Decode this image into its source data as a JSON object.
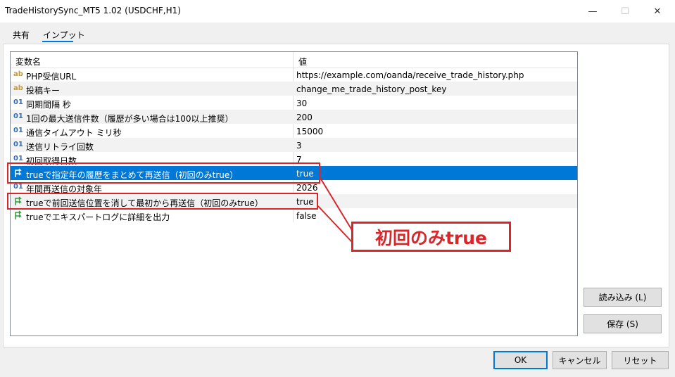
{
  "window": {
    "title": "TradeHistorySync_MT5 1.02 (USDCHF,H1)",
    "minimize_glyph": "—",
    "maximize_glyph": "☐",
    "close_glyph": "✕"
  },
  "tabs": [
    {
      "label": "共有",
      "selected": false
    },
    {
      "label": "インプット",
      "selected": true
    }
  ],
  "grid": {
    "headers": {
      "name": "変数名",
      "value": "値"
    },
    "rows": [
      {
        "icon": "ab",
        "name": "PHP受信URL",
        "value": "https://example.com/oanda/receive_trade_history.php"
      },
      {
        "icon": "ab",
        "name": "投稿キー",
        "value": "change_me_trade_history_post_key"
      },
      {
        "icon": "01",
        "name": "同期間隔 秒",
        "value": "30"
      },
      {
        "icon": "01",
        "name": "1回の最大送信件数（履歴が多い場合は100以上推奨）",
        "value": "200"
      },
      {
        "icon": "01",
        "name": "通信タイムアウト ミリ秒",
        "value": "15000"
      },
      {
        "icon": "01",
        "name": "送信リトライ回数",
        "value": "3"
      },
      {
        "icon": "01",
        "name": "初回取得日数",
        "value": "7"
      },
      {
        "icon": "bool",
        "name": "trueで指定年の履歴をまとめて再送信（初回のみtrue）",
        "value": "true"
      },
      {
        "icon": "01",
        "name": "年間再送信の対象年",
        "value": "2026"
      },
      {
        "icon": "bool",
        "name": "trueで前回送信位置を消して最初から再送信（初回のみtrue）",
        "value": "true"
      },
      {
        "icon": "bool",
        "name": "trueでエキスパートログに詳細を出力",
        "value": "false"
      }
    ]
  },
  "annotation": {
    "text": "初回のみtrue",
    "color": "#d8262b"
  },
  "side_buttons": {
    "load": "読み込み (L)",
    "save": "保存 (S)"
  },
  "footer_buttons": {
    "ok": "OK",
    "cancel": "キャンセル",
    "reset": "リセット"
  },
  "colors": {
    "selection": "#0078d7",
    "annotation": "#d8262b"
  }
}
